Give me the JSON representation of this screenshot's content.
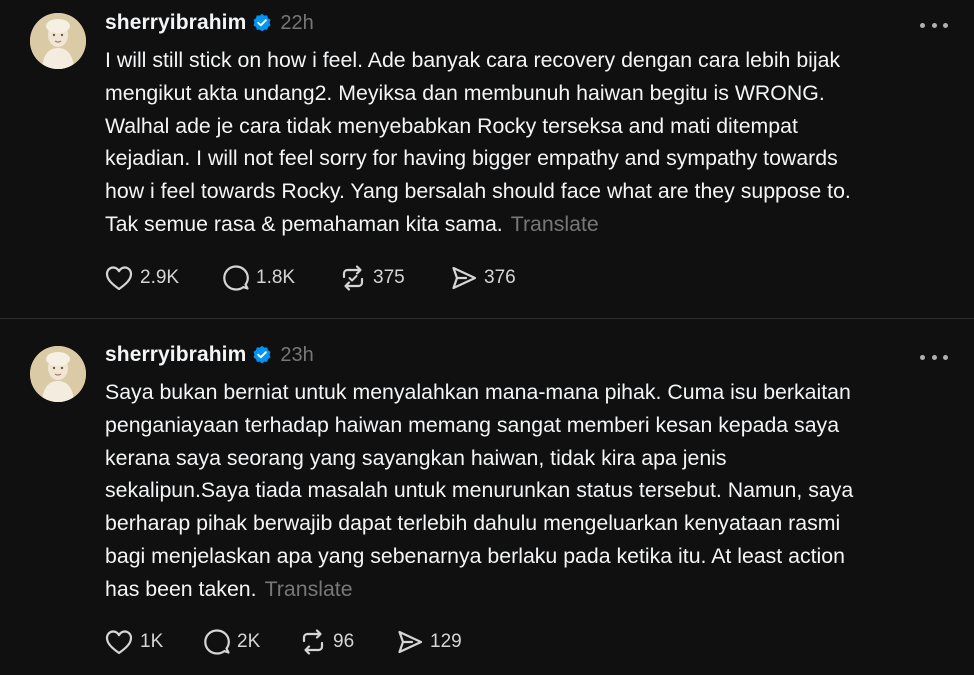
{
  "posts": [
    {
      "username": "sherryibrahim",
      "verified": true,
      "time": "22h",
      "text": "I will still stick on how i feel. Ade banyak cara recovery dengan cara lebih bijak\nmengikut akta undang2. Meyiksa dan membunuh haiwan begitu is WRONG.\nWalhal ade je cara tidak menyebabkan Rocky terseksa and mati ditempat\nkejadian. I will not feel sorry for having bigger empathy and sympathy towards\nhow i feel towards Rocky. Yang bersalah should face what are they suppose to.\nTak semue rasa & pemahaman kita sama.",
      "translate_label": "Translate",
      "likes": "2.9K",
      "replies": "1.8K",
      "reposts": "375",
      "shares": "376"
    },
    {
      "username": "sherryibrahim",
      "verified": true,
      "time": "23h",
      "text": "Saya bukan berniat untuk menyalahkan mana-mana pihak. Cuma isu berkaitan\npenganiayaan terhadap haiwan memang sangat memberi kesan kepada saya\nkerana saya seorang yang sayangkan haiwan, tidak kira apa jenis\nsekalipun.Saya tiada masalah untuk menurunkan status tersebut. Namun, saya\nberharap pihak berwajib dapat terlebih dahulu mengeluarkan kenyataan rasmi\nbagi menjelaskan apa yang sebenarnya berlaku pada ketika itu. At least action\nhas been taken.",
      "translate_label": "Translate",
      "likes": "1K",
      "replies": "2K",
      "reposts": "96",
      "shares": "129"
    }
  ],
  "icons": {
    "verified": "verified-badge-icon",
    "more": "more-options-icon",
    "like": "heart-icon",
    "reply": "comment-icon",
    "repost": "repost-icon",
    "share": "share-icon"
  },
  "colors": {
    "background": "#101010",
    "text": "#f3f5f7",
    "muted": "#777777",
    "verified": "#0095f6",
    "divider": "#2d2d2d"
  }
}
